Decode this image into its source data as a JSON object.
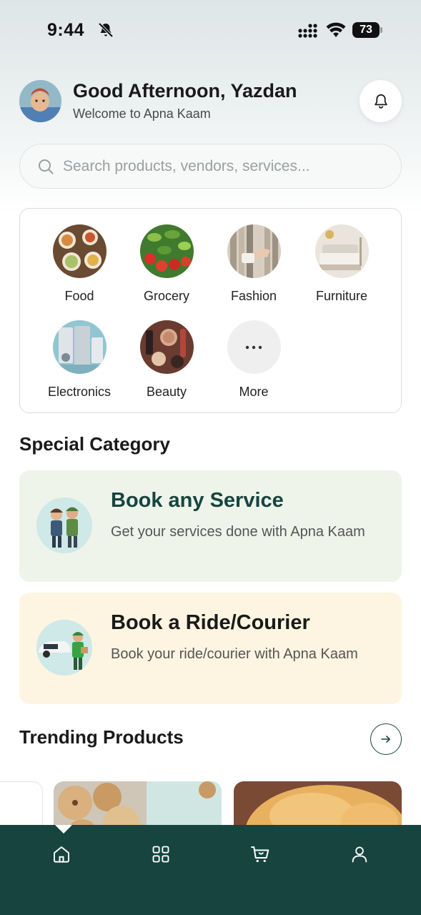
{
  "status_bar": {
    "time": "9:44",
    "battery": "73"
  },
  "header": {
    "greeting": "Good Afternoon, Yazdan",
    "subtitle": "Welcome to Apna Kaam"
  },
  "search": {
    "placeholder": "Search products, vendors, services..."
  },
  "categories": [
    {
      "label": "Food",
      "icon": "food-image"
    },
    {
      "label": "Grocery",
      "icon": "grocery-image"
    },
    {
      "label": "Fashion",
      "icon": "fashion-image"
    },
    {
      "label": "Furniture",
      "icon": "furniture-image"
    },
    {
      "label": "Electronics",
      "icon": "electronics-image"
    },
    {
      "label": "Beauty",
      "icon": "beauty-image"
    },
    {
      "label": "More",
      "icon": "more-dots-icon"
    }
  ],
  "special_category": {
    "title": "Special Category",
    "cards": [
      {
        "title": "Book any Service",
        "description": "Get your services done with Apna Kaam",
        "title_color": "#17443f",
        "background": "#eef4ea"
      },
      {
        "title": "Book a Ride/Courier",
        "description": "Book your ride/courier with Apna Kaam",
        "title_color": "#1a1a1a",
        "background": "#fdf5e1"
      }
    ]
  },
  "trending": {
    "title": "Trending Products"
  },
  "bottom_nav": [
    {
      "name": "home",
      "icon": "home-icon",
      "active": true
    },
    {
      "name": "categories",
      "icon": "grid-icon",
      "active": false
    },
    {
      "name": "cart",
      "icon": "cart-icon",
      "active": false
    },
    {
      "name": "profile",
      "icon": "user-icon",
      "active": false
    }
  ],
  "colors": {
    "primary": "#17443f",
    "service_bg": "#eef4ea",
    "ride_bg": "#fdf5e1"
  }
}
